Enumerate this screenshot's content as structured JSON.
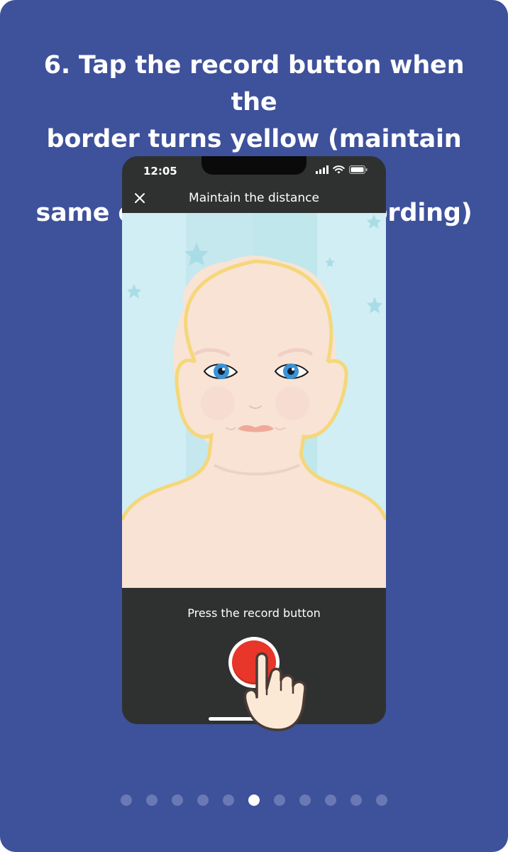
{
  "instruction": {
    "line1": "6. Tap the record button when the",
    "line2": "border turns yellow (maintain the",
    "line3": "same distance when recording)"
  },
  "phone": {
    "status_bar": {
      "time": "12:05",
      "icons": [
        "signal-icon",
        "wifi-icon",
        "battery-icon"
      ]
    },
    "header": {
      "close_icon": "close-icon",
      "title": "Maintain the distance"
    },
    "prompt": "Press the record button",
    "record_button_icon": "record-icon"
  },
  "pager": {
    "total": 11,
    "current": 6
  },
  "colors": {
    "background": "#3e519b",
    "phone": "#2f3131",
    "face_outline": "#f5d77a",
    "record": "#e8362a",
    "dot_inactive": "#6a79b4",
    "dot_active": "#ffffff"
  }
}
